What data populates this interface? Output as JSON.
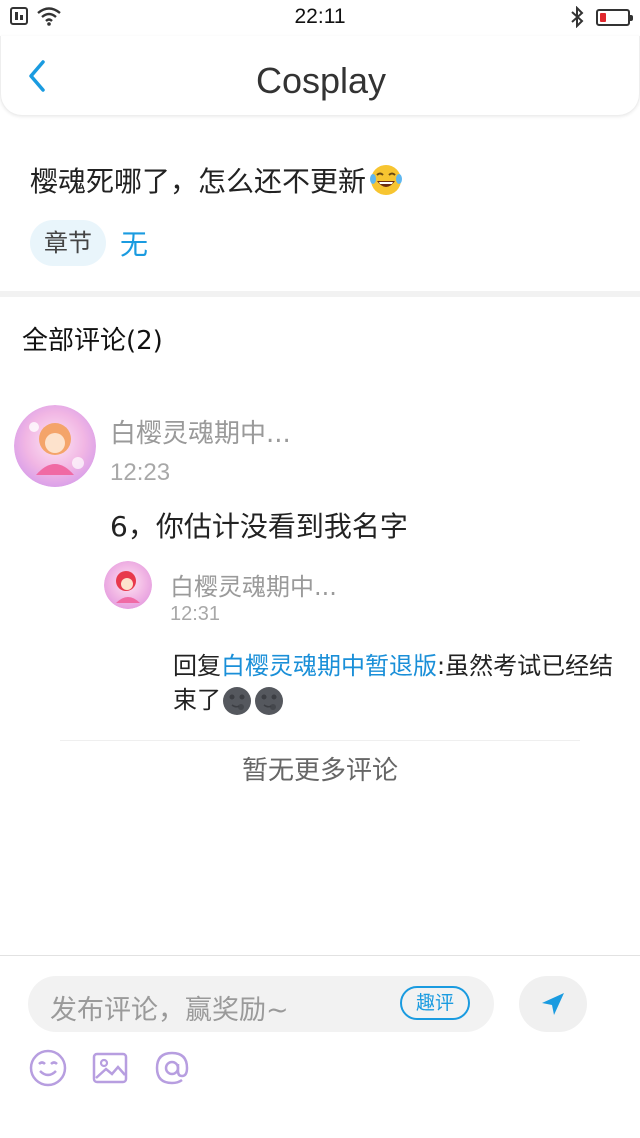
{
  "status_bar": {
    "time": "22:11"
  },
  "header": {
    "title": "Cosplay"
  },
  "post": {
    "text": "樱魂死哪了，怎么还不更新",
    "chapter_label": "章节",
    "chapter_value": "无"
  },
  "comments": {
    "header": "全部评论(2)",
    "main": {
      "user": "白樱灵魂期中...",
      "time": "12:23",
      "text": "6，你估计没看到我名字"
    },
    "reply": {
      "user": "白樱灵魂期中...",
      "time": "12:31",
      "prefix": "回复",
      "mention": "白樱灵魂期中暂退版",
      "body": ":虽然考试已经结束了"
    },
    "no_more": "暂无更多评论"
  },
  "composer": {
    "placeholder": "发布评论，赢奖励~",
    "qp_label": "趣评"
  },
  "colors": {
    "accent": "#1a9be0",
    "link": "#1a8fd8",
    "tool_icon": "#b79ee0"
  },
  "icons": [
    "wifi-icon",
    "bluetooth-icon",
    "battery-icon",
    "back-chevron-icon",
    "laughing-emoji",
    "moon-emoji",
    "send-icon",
    "emoji-icon",
    "image-icon",
    "at-icon"
  ]
}
